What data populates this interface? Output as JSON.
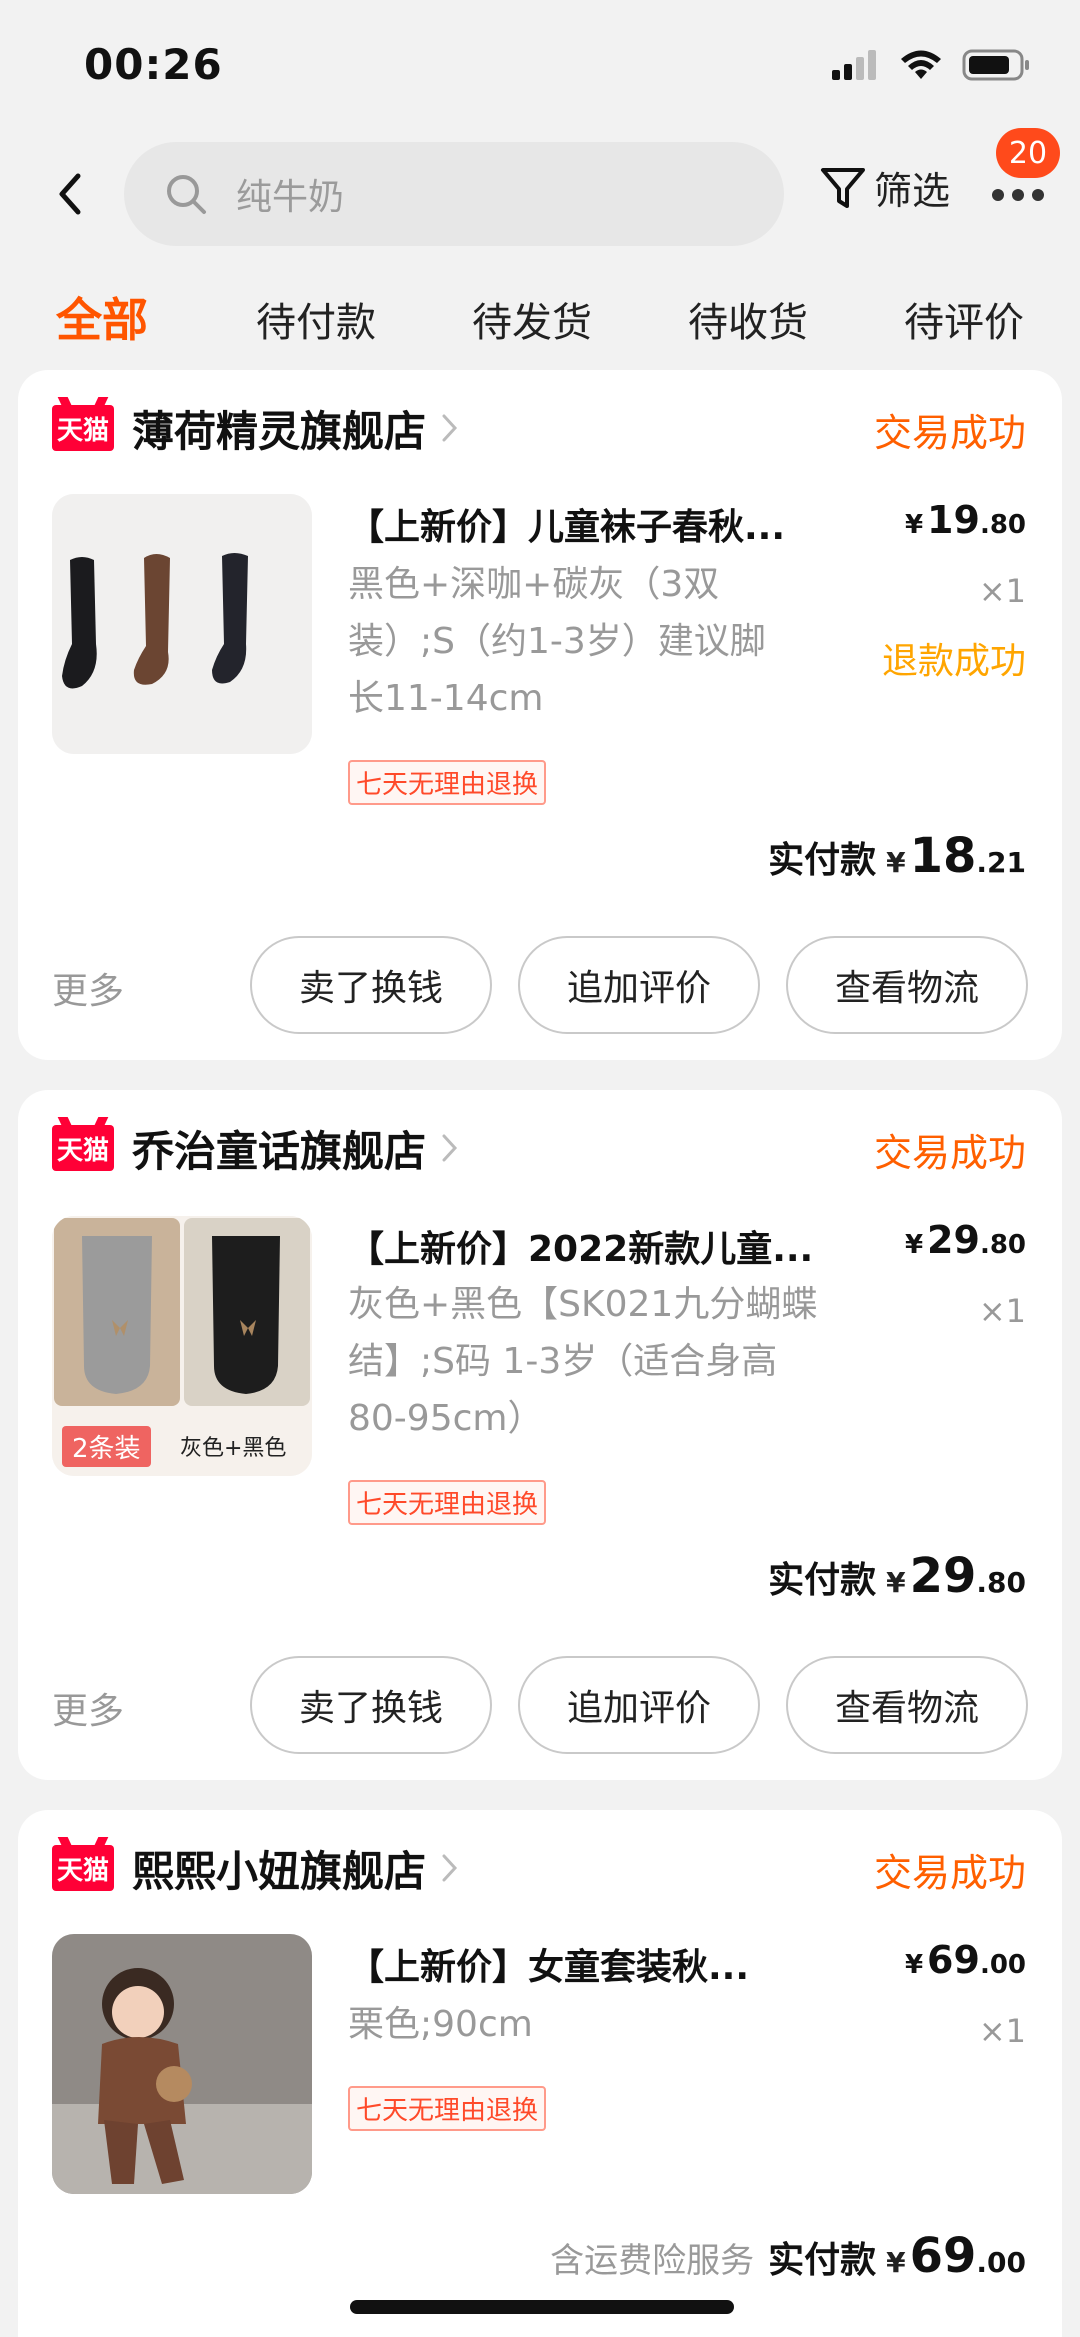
{
  "status_bar": {
    "time": "00:26"
  },
  "header": {
    "search_placeholder": "纯牛奶",
    "filter_label": "筛选",
    "badge_count": "20"
  },
  "tabs": [
    {
      "label": "全部",
      "active": true
    },
    {
      "label": "待付款"
    },
    {
      "label": "待发货"
    },
    {
      "label": "待收货"
    },
    {
      "label": "待评价"
    }
  ],
  "orders": [
    {
      "store": "薄荷精灵旗舰店",
      "status": "交易成功",
      "product_title": "【上新价】儿童袜子春秋...",
      "spec_lines": [
        "黑色+深咖+碳灰（3双",
        "装）;S（约1-3岁）建议脚",
        "长11-14cm"
      ],
      "price_currency": "¥",
      "price_int": "19",
      "price_dec": ".80",
      "qty": "×1",
      "refund": "退款成功",
      "tag": "七天无理由退换",
      "paid_label": "实付款",
      "paid_currency": "¥",
      "paid_int": "18",
      "paid_dec": ".21",
      "more": "更多",
      "buttons": [
        "卖了换钱",
        "追加评价",
        "查看物流"
      ]
    },
    {
      "store": "乔治童话旗舰店",
      "status": "交易成功",
      "product_title": "【上新价】2022新款儿童...",
      "spec_lines": [
        "灰色+黑色【SK021九分蝴蝶",
        "结】;S码 1-3岁（适合身高",
        "80-95cm）"
      ],
      "price_currency": "¥",
      "price_int": "29",
      "price_dec": ".80",
      "qty": "×1",
      "tag": "七天无理由退换",
      "thumb_badge": "2条装",
      "thumb_caption": "灰色+黑色",
      "paid_label": "实付款",
      "paid_currency": "¥",
      "paid_int": "29",
      "paid_dec": ".80",
      "more": "更多",
      "buttons": [
        "卖了换钱",
        "追加评价",
        "查看物流"
      ]
    },
    {
      "store": "熙熙小妞旗舰店",
      "status": "交易成功",
      "product_title": "【上新价】女童套装秋...",
      "spec_lines": [
        "栗色;90cm"
      ],
      "price_currency": "¥",
      "price_int": "69",
      "price_dec": ".00",
      "qty": "×1",
      "tag": "七天无理由退换",
      "service": "含运费险服务",
      "paid_label": "实付款",
      "paid_currency": "¥",
      "paid_int": "69",
      "paid_dec": ".00"
    }
  ],
  "tmall_logo_text": "天猫",
  "colors": {
    "accent": "#ff5500",
    "refund": "#ffa500",
    "tmall": "#ff0036"
  }
}
